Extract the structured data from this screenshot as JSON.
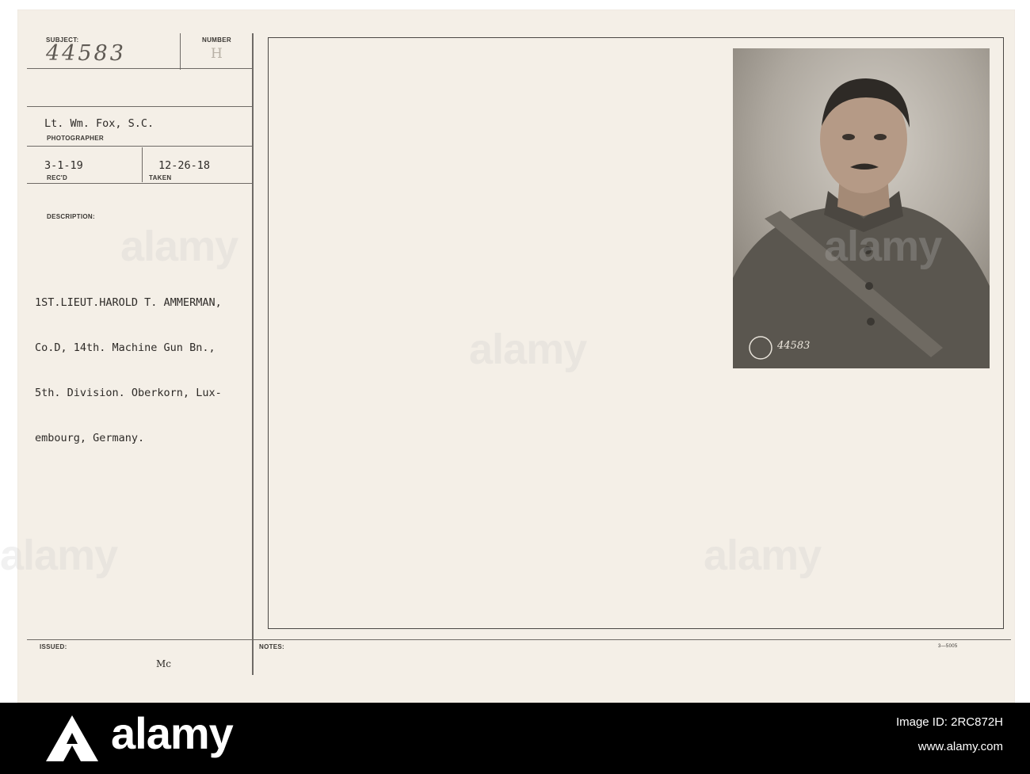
{
  "card": {
    "subject_label": "SUBJECT:",
    "subject_value": "44583",
    "number_label": "NUMBER",
    "number_value": "H",
    "photographer_name": "Lt. Wm. Fox, S.C.",
    "photographer_label": "PHOTOGRAPHER",
    "received_date": "3-1-19",
    "received_label": "REC'D",
    "taken_date": "12-26-18",
    "taken_label": "TAKEN",
    "description_label": "DESCRIPTION:",
    "description_lines": [
      "1ST.LIEUT.HAROLD T. AMMERMAN,",
      "Co.D, 14th. Machine Gun Bn.,",
      "5th. Division. Oberkorn, Lux-",
      "embourg, Germany."
    ],
    "issued_label": "ISSUED:",
    "issued_value": "Mc",
    "notes_label": "NOTES:",
    "form_number": "3—5005",
    "photo_stamp": "44583"
  },
  "watermark": {
    "brand": "alamy",
    "image_id_label": "Image ID: 2RC872H",
    "site": "www.alamy.com"
  },
  "colors": {
    "card_bg": "#f4efe7",
    "rule": "#6e6a66",
    "photo_tone": "#a9a39a",
    "footer_bg": "#000000"
  }
}
